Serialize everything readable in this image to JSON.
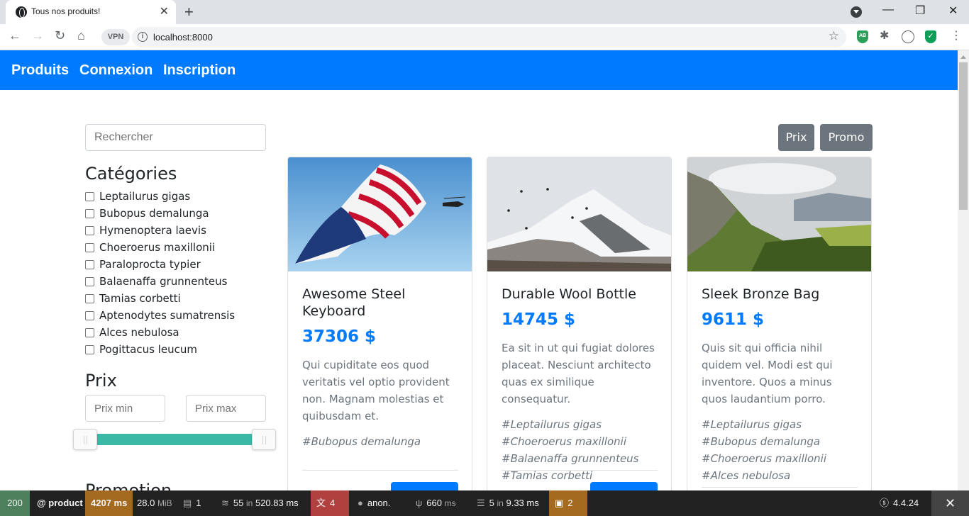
{
  "browser": {
    "tab_title": "Tous nos produits!",
    "url": "localhost:8000",
    "vpn_label": "VPN",
    "ext_ab": "AB"
  },
  "navbar": {
    "links": [
      "Produits",
      "Connexion",
      "Inscription"
    ],
    "color": "#007bff"
  },
  "sidebar": {
    "search_placeholder": "Rechercher",
    "categories_title": "Catégories",
    "categories": [
      "Leptailurus gigas",
      "Bubopus demalunga",
      "Hymenoptera laevis",
      "Choeroerus maxillonii",
      "Paraloprocta typier",
      "Balaenaffa grunnenteus",
      "Tamias corbetti",
      "Aptenodytes sumatrensis",
      "Alces nebulosa",
      "Pogittacus leucum"
    ],
    "price_title": "Prix",
    "price_min_placeholder": "Prix min",
    "price_max_placeholder": "Prix max",
    "promotion_title": "Promotion"
  },
  "sort_buttons": [
    "Prix",
    "Promo"
  ],
  "products": [
    {
      "title": "Awesome Steel Keyboard",
      "price": "37306 $",
      "description": "Qui cupiditate eos quod veritatis vel optio provident non. Magnam molestias et quibusdam et.",
      "tags": "#Bubopus demalunga",
      "image": "flag-photo"
    },
    {
      "title": "Durable Wool Bottle",
      "price": "14745 $",
      "description": "Ea sit in ut qui fugiat dolores placeat. Nesciunt architecto quas ex similique consequatur.",
      "tags": "#Leptailurus gigas #Choeroerus maxillonii #Balaenaffa grunnenteus #Tamias corbetti",
      "image": "snowy-mountain-photo"
    },
    {
      "title": "Sleek Bronze Bag",
      "price": "9611 $",
      "description": "Quis sit qui officia nihil quidem vel. Modi est qui inventore. Quos a minus quos laudantium porro.",
      "tags": "#Leptailurus gigas #Bubopus demalunga #Choeroerus maxillonii #Alces nebulosa",
      "image": "green-valley-photo"
    }
  ],
  "debug_toolbar": {
    "status": "200",
    "route": "@ product",
    "time": "4207 ms",
    "memory": "28.0",
    "memory_unit": "MiB",
    "forms": "1",
    "cache_count": "55",
    "cache_in": "in",
    "cache_time": "520.83 ms",
    "translation": "4",
    "user": "anon.",
    "twig_time": "660",
    "twig_unit": "ms",
    "db_count": "5",
    "db_in": "in",
    "db_time": "9.33 ms",
    "logs": "2",
    "version": "4.4.24",
    "colors": {
      "status_bg": "#4f805d",
      "time_bg": "#a46a1f",
      "translation_bg": "#b0413e"
    }
  }
}
